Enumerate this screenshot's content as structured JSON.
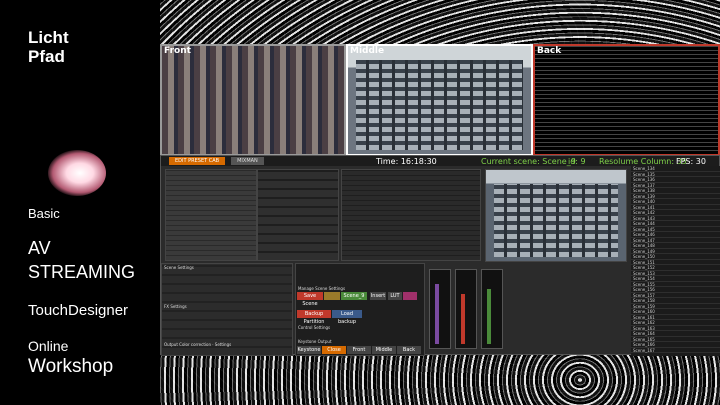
{
  "branding": {
    "line1": "Licht",
    "line2": "Pfad"
  },
  "workshop": {
    "level": "Basic",
    "title1": "AV",
    "title2": "STREAMING",
    "tool": "TouchDesigner",
    "mode": "Online",
    "format": "Workshop"
  },
  "cameras": {
    "front": "Front",
    "middle": "Middle",
    "back": "Back"
  },
  "header": {
    "tab_active": "EDIT PRESET CAB",
    "tab_other": "MIXMAN",
    "time": "Time: 16:18:30",
    "current_scene": "Current scene: Scene_9",
    "id": "id: 9",
    "resolume_column": "Resolume Column: 35",
    "fps": "FPS: 30"
  },
  "buttons": {
    "save_scene": "Save Scene",
    "scene_value": "Scene_9",
    "insert": "Insert",
    "lut": "LUT",
    "keystone": "Keystone",
    "close": "Close",
    "front": "Front",
    "middle": "Middle",
    "back": "Back",
    "backup_partition": "Backup Partition",
    "load_backup": "Load backup"
  },
  "sections": {
    "scene_settings": "Scene Settings",
    "manage_scene": "Manage Scene Settings",
    "control_settings": "Control Settings",
    "keystone_output": "Keystone Output",
    "fx_settings": "FX Settings",
    "output_color": "Output Color correction · Settings"
  },
  "scenes": [
    "Scene_134",
    "Scene_135",
    "Scene_136",
    "Scene_137",
    "Scene_138",
    "Scene_139",
    "Scene_140",
    "Scene_141",
    "Scene_142",
    "Scene_143",
    "Scene_144",
    "Scene_145",
    "Scene_146",
    "Scene_147",
    "Scene_148",
    "Scene_149",
    "Scene_150",
    "Scene_151",
    "Scene_152",
    "Scene_153",
    "Scene_154",
    "Scene_155",
    "Scene_156",
    "Scene_157",
    "Scene_158",
    "Scene_159",
    "Scene_160",
    "Scene_161",
    "Scene_162",
    "Scene_163",
    "Scene_164",
    "Scene_165",
    "Scene_166",
    "Scene_167"
  ]
}
